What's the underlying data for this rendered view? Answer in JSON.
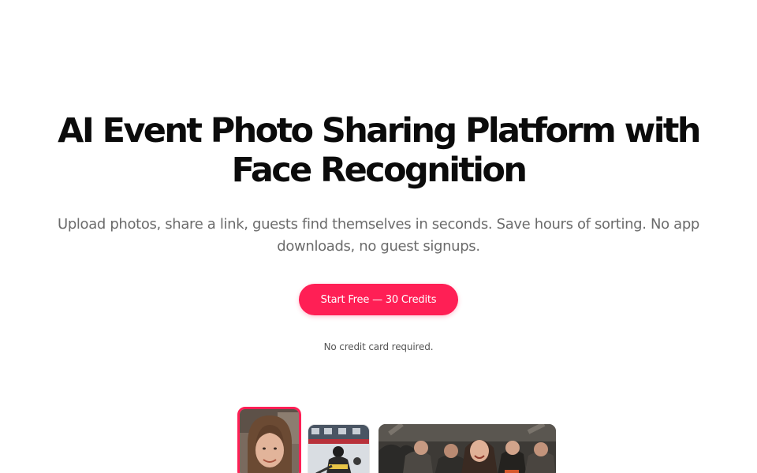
{
  "hero": {
    "title": "AI Event Photo Sharing Platform with Face Recognition",
    "subtitle": "Upload photos, share a link, guests find themselves in seconds. Save hours of sorting. No app downloads, no guest signups.",
    "cta_label": "Start Free — 30 Credits",
    "note": "No credit card required."
  },
  "colors": {
    "accent": "#ff1f55",
    "title": "#0b0b0b",
    "subtitle": "#6b6b6b",
    "background": "#ffffff"
  },
  "gallery": {
    "photos": [
      {
        "subject": "smiling woman portrait",
        "selected": true
      },
      {
        "subject": "hockey players on ice",
        "selected": false
      },
      {
        "subject": "crowd cheering at party",
        "selected": false
      }
    ]
  }
}
